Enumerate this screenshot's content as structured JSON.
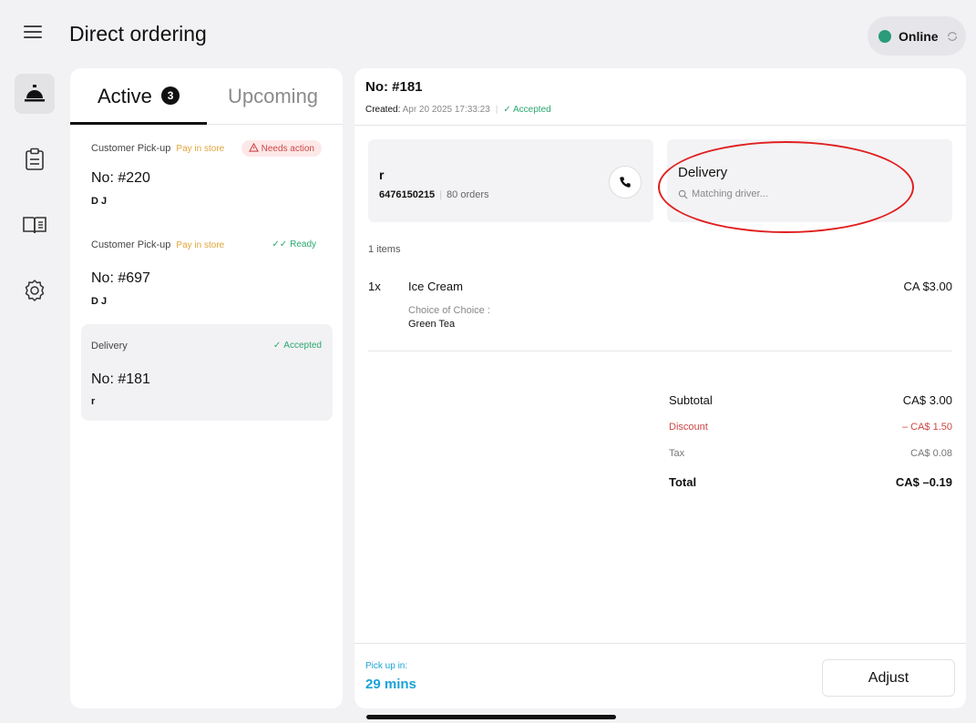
{
  "header": {
    "title": "Direct ordering",
    "status_label": "Online",
    "status_color": "#2b9b7a"
  },
  "sidebar": {
    "items": [
      {
        "icon": "bell-icon",
        "active": true
      },
      {
        "icon": "clipboard-icon",
        "active": false
      },
      {
        "icon": "book-icon",
        "active": false
      },
      {
        "icon": "gear-icon",
        "active": false
      }
    ]
  },
  "tabs": {
    "active_label": "Active",
    "active_count": "3",
    "upcoming_label": "Upcoming"
  },
  "orders": [
    {
      "type": "Customer Pick-up",
      "payment": "Pay in store",
      "status": "Needs action",
      "number": "No: #220",
      "customer": "D J"
    },
    {
      "type": "Customer Pick-up",
      "payment": "Pay in store",
      "status": "Ready",
      "number": "No: #697",
      "customer": "D J"
    },
    {
      "type": "Delivery",
      "payment": "",
      "status": "Accepted",
      "number": "No: #181",
      "customer": "r"
    }
  ],
  "detail": {
    "number": "No: #181",
    "created_label": "Created:",
    "created_value": "Apr 20 2025 17:33:23",
    "status": "Accepted",
    "customer": {
      "name": "r",
      "phone": "6476150215",
      "orders": "80 orders"
    },
    "delivery": {
      "title": "Delivery",
      "status": "Matching driver..."
    },
    "items_count": "1 items",
    "items": [
      {
        "qty": "1x",
        "name": "Ice Cream",
        "price": "CA $3.00",
        "option_label": "Choice of Choice :",
        "option_value": "Green Tea"
      }
    ],
    "summary": {
      "subtotal_label": "Subtotal",
      "subtotal_value": "CA$ 3.00",
      "discount_label": "Discount",
      "discount_value": "– CA$ 1.50",
      "tax_label": "Tax",
      "tax_value": "CA$ 0.08",
      "total_label": "Total",
      "total_value": "CA$ –0.19"
    },
    "pickup_label": "Pick up in:",
    "pickup_value": "29 mins",
    "adjust_label": "Adjust"
  }
}
